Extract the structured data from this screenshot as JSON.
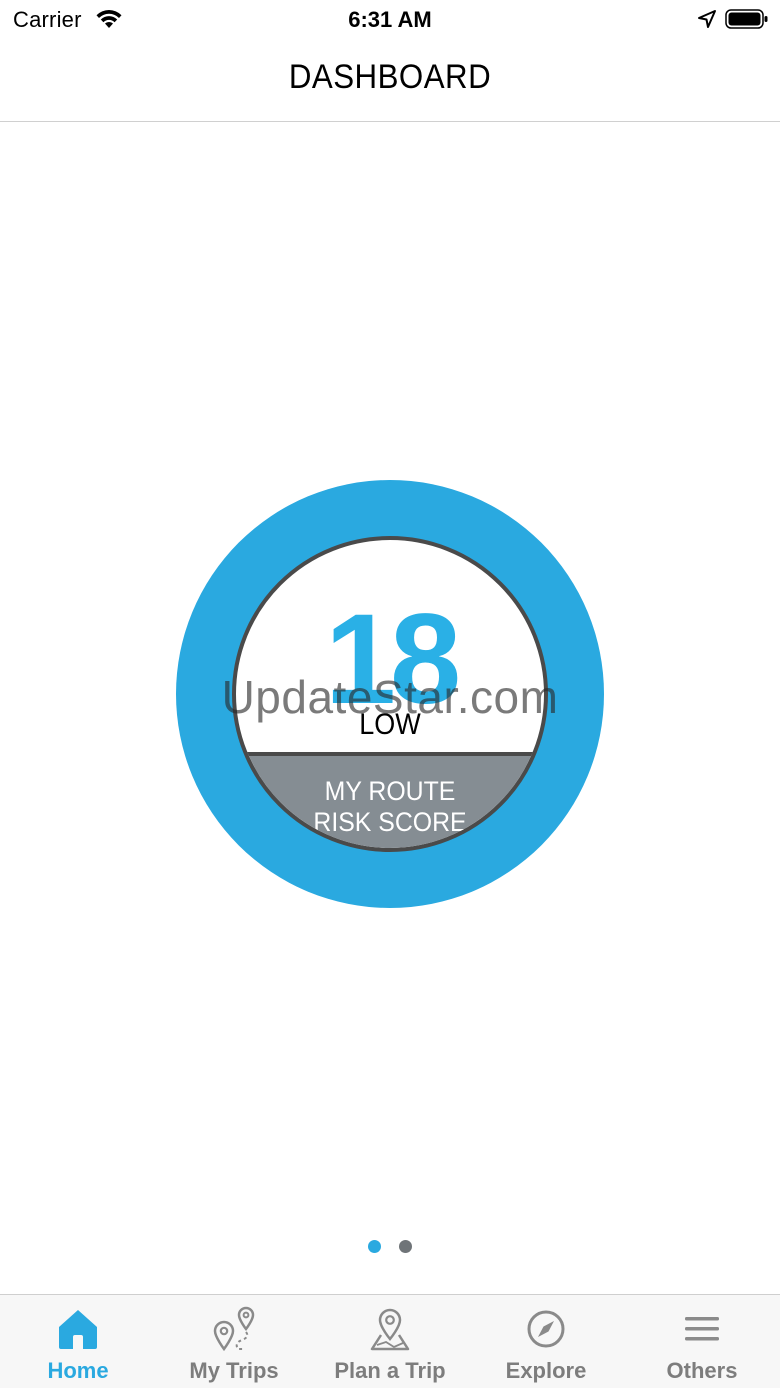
{
  "status_bar": {
    "carrier": "Carrier",
    "time": "6:31 AM",
    "icons": [
      "wifi-icon",
      "location-arrow-icon",
      "battery-icon"
    ]
  },
  "header": {
    "title": "DASHBOARD"
  },
  "risk_gauge": {
    "score": "18",
    "level": "LOW",
    "label_line1": "MY ROUTE",
    "label_line2": "RISK SCORE"
  },
  "watermark": "UpdateStar.com",
  "pager": {
    "current_page": 1,
    "total_pages": 2
  },
  "tabs": [
    {
      "label": "Home",
      "icon": "home-icon",
      "active": true
    },
    {
      "label": "My Trips",
      "icon": "my-trips-icon",
      "active": false
    },
    {
      "label": "Plan a Trip",
      "icon": "plan-trip-icon",
      "active": false
    },
    {
      "label": "Explore",
      "icon": "compass-icon",
      "active": false
    },
    {
      "label": "Others",
      "icon": "menu-icon",
      "active": false
    }
  ],
  "colors": {
    "accent": "#2aa9e0",
    "inactive_tab": "#7d7d7d",
    "gauge_bottom": "#858d93",
    "gauge_border": "#4a4a4a"
  }
}
